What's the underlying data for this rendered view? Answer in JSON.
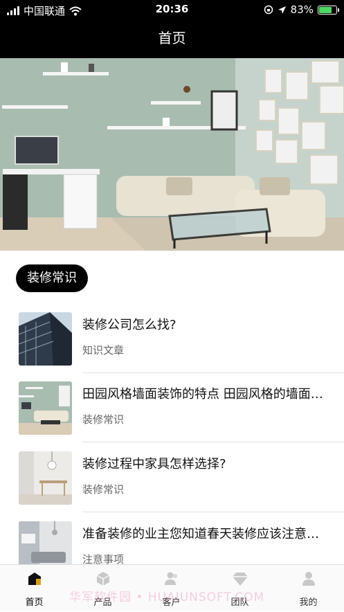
{
  "status_bar": {
    "carrier": "中国联通",
    "time": "20:36",
    "battery": "83%",
    "battery_level": 0.83
  },
  "nav": {
    "title": "首页"
  },
  "section": {
    "label": "装修常识"
  },
  "articles": [
    {
      "title": "装修公司怎么找?",
      "category": "知识文章",
      "thumb": "building"
    },
    {
      "title": "田园风格墙面装饰的特点 田园风格的墙面装饰方法",
      "category": "装修常识",
      "thumb": "green-room"
    },
    {
      "title": "装修过程中家具怎样选择?",
      "category": "装修常识",
      "thumb": "dining-room"
    },
    {
      "title": "准备装修的业主您知道春天装修应该注意什么吗",
      "category": "注意事项",
      "thumb": "living-room"
    }
  ],
  "tabs": [
    {
      "label": "首页",
      "icon": "home-icon",
      "active": true
    },
    {
      "label": "产品",
      "icon": "cube-icon",
      "active": false
    },
    {
      "label": "客户",
      "icon": "customers-icon",
      "active": false
    },
    {
      "label": "团队",
      "icon": "diamond-icon",
      "active": false
    },
    {
      "label": "我的",
      "icon": "user-icon",
      "active": false
    }
  ],
  "watermark": "华军软件园 • HUAJUNSOFT.COM",
  "colors": {
    "accent": "#000000",
    "section_text": "#ffffff",
    "battery_fill": "#4cd964"
  }
}
